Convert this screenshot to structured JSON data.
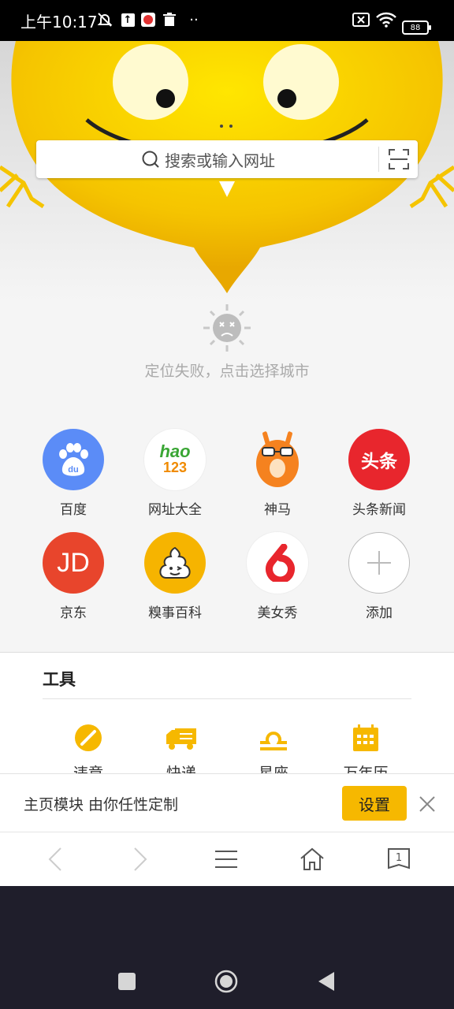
{
  "status_bar": {
    "time": "上午10:17",
    "battery": "88",
    "icons": [
      "mute-bell-icon",
      "upload-icon",
      "app-notification-icon",
      "trash-icon",
      "more-dots-icon",
      "no-sim-icon",
      "wifi-icon",
      "battery-icon"
    ]
  },
  "search": {
    "placeholder": "搜索或输入网址",
    "scan_icon": "scan-icon"
  },
  "weather": {
    "icon": "sad-sun-icon",
    "message": "定位失败，点击选择城市"
  },
  "shortcuts": [
    {
      "label": "百度",
      "icon": "baidu-icon",
      "color": "#5b8cf7"
    },
    {
      "label": "网址大全",
      "icon": "hao123-icon",
      "color": "#ffffff"
    },
    {
      "label": "神马",
      "icon": "shenma-alpaca-icon",
      "color": "#f5821f"
    },
    {
      "label": "头条新闻",
      "icon": "toutiao-icon",
      "color": "#e8262d"
    },
    {
      "label": "京东",
      "icon": "jd-icon",
      "color": "#e8452c"
    },
    {
      "label": "糗事百科",
      "icon": "qiushi-icon",
      "color": "#f6b400"
    },
    {
      "label": "美女秀",
      "icon": "meinvxiu-icon",
      "color": "#ffffff"
    },
    {
      "label": "添加",
      "icon": "plus-icon",
      "color": "#ffffff"
    }
  ],
  "hao123_text": {
    "top": "hao",
    "bottom": "123"
  },
  "toutiao_text": "头条",
  "jd_text": "JD",
  "tools": {
    "title": "工具",
    "items": [
      {
        "label": "违章",
        "icon": "no-entry-icon"
      },
      {
        "label": "快递",
        "icon": "truck-icon"
      },
      {
        "label": "星座",
        "icon": "libra-icon"
      },
      {
        "label": "万年历",
        "icon": "calendar-icon"
      }
    ],
    "accent": "#f6b800"
  },
  "banner": {
    "text": "主页模块 由你任性定制",
    "button": "设置"
  },
  "toolbar": {
    "tab_count": "1",
    "icons": [
      "back-icon",
      "forward-icon",
      "menu-icon",
      "home-icon",
      "tabs-icon"
    ]
  },
  "system_nav": {
    "icons": [
      "recents-square-icon",
      "home-circle-icon",
      "back-triangle-icon"
    ]
  }
}
